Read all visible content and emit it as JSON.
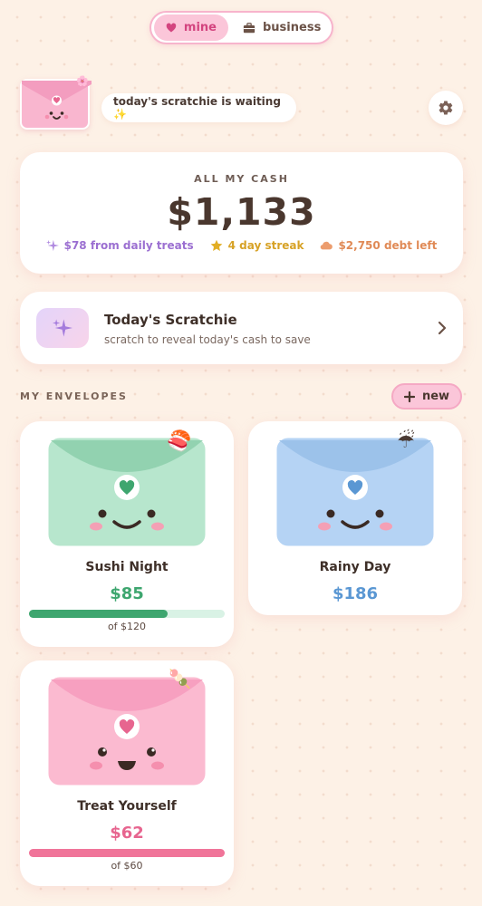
{
  "toggle": {
    "mine_label": "mine",
    "business_label": "business",
    "active": "mine"
  },
  "header": {
    "bubble_text": "today's scratchie is waiting ✨"
  },
  "cash": {
    "label": "ALL MY CASH",
    "amount": "$1,133",
    "stats": [
      {
        "icon": "sparkle-icon",
        "text": "$78 from daily treats",
        "color": "#9b6fd1"
      },
      {
        "icon": "star-icon",
        "text": "4 day streak",
        "color": "#d7a226"
      },
      {
        "icon": "cloud-icon",
        "text": "$2,750 debt left",
        "color": "#e08a56"
      }
    ]
  },
  "scratchie": {
    "title": "Today's Scratchie",
    "subtitle": "scratch to reveal today's cash to save"
  },
  "envelopes": {
    "section_label": "MY ENVELOPES",
    "new_label": "new",
    "items": [
      {
        "name": "Sushi Night",
        "amount": "$85",
        "goal": "of $120",
        "progress": 0.708,
        "emoji": "🍣",
        "color": "#b7e6cd",
        "accent": "#3ea66f",
        "heart": "#3ea66f",
        "track": "#d9f2e5"
      },
      {
        "name": "Rainy Day",
        "amount": "$186",
        "goal": "",
        "emoji": "☔",
        "color": "#b5d3f4",
        "accent": "#5a97d3",
        "heart": "#5a97d3"
      },
      {
        "name": "Treat Yourself",
        "amount": "$62",
        "goal": "of $60",
        "progress": 1.0,
        "emoji": "🍡",
        "color": "#fbbad0",
        "accent": "#e7658f",
        "heart": "#e7658f",
        "track": "#fbd6e3"
      }
    ]
  }
}
